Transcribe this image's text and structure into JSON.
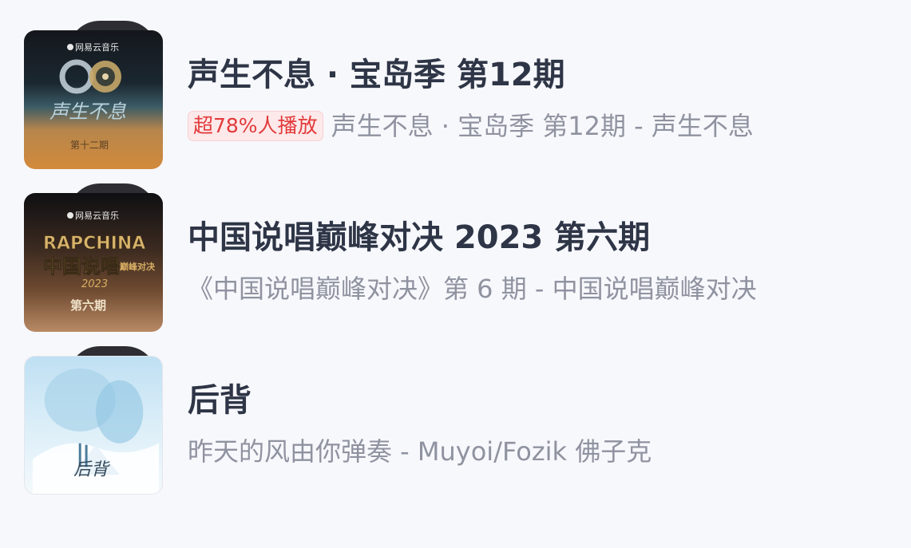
{
  "items": [
    {
      "title": "声生不息 · 宝岛季 第12期",
      "badge": "超78%人播放",
      "subtitle": "声生不息 · 宝岛季 第12期 - 声生不息",
      "cover": {
        "brand": "网易云音乐",
        "name": "声生不息",
        "episode": "第十二期"
      }
    },
    {
      "title": "中国说唱巅峰对决 2023 第六期",
      "subtitle": "《中国说唱巅峰对决》第 6 期 - 中国说唱巅峰对决",
      "cover": {
        "brand": "网易云音乐",
        "logo": "RAPCHINA",
        "name": "中国说唱",
        "side": "巅峰对决",
        "year": "2023",
        "episode": "第六期"
      }
    },
    {
      "title": "后背",
      "subtitle": "昨天的风由你弹奏 - Muyoi/Fozik 佛子克",
      "cover": {
        "script": "后背"
      }
    }
  ]
}
